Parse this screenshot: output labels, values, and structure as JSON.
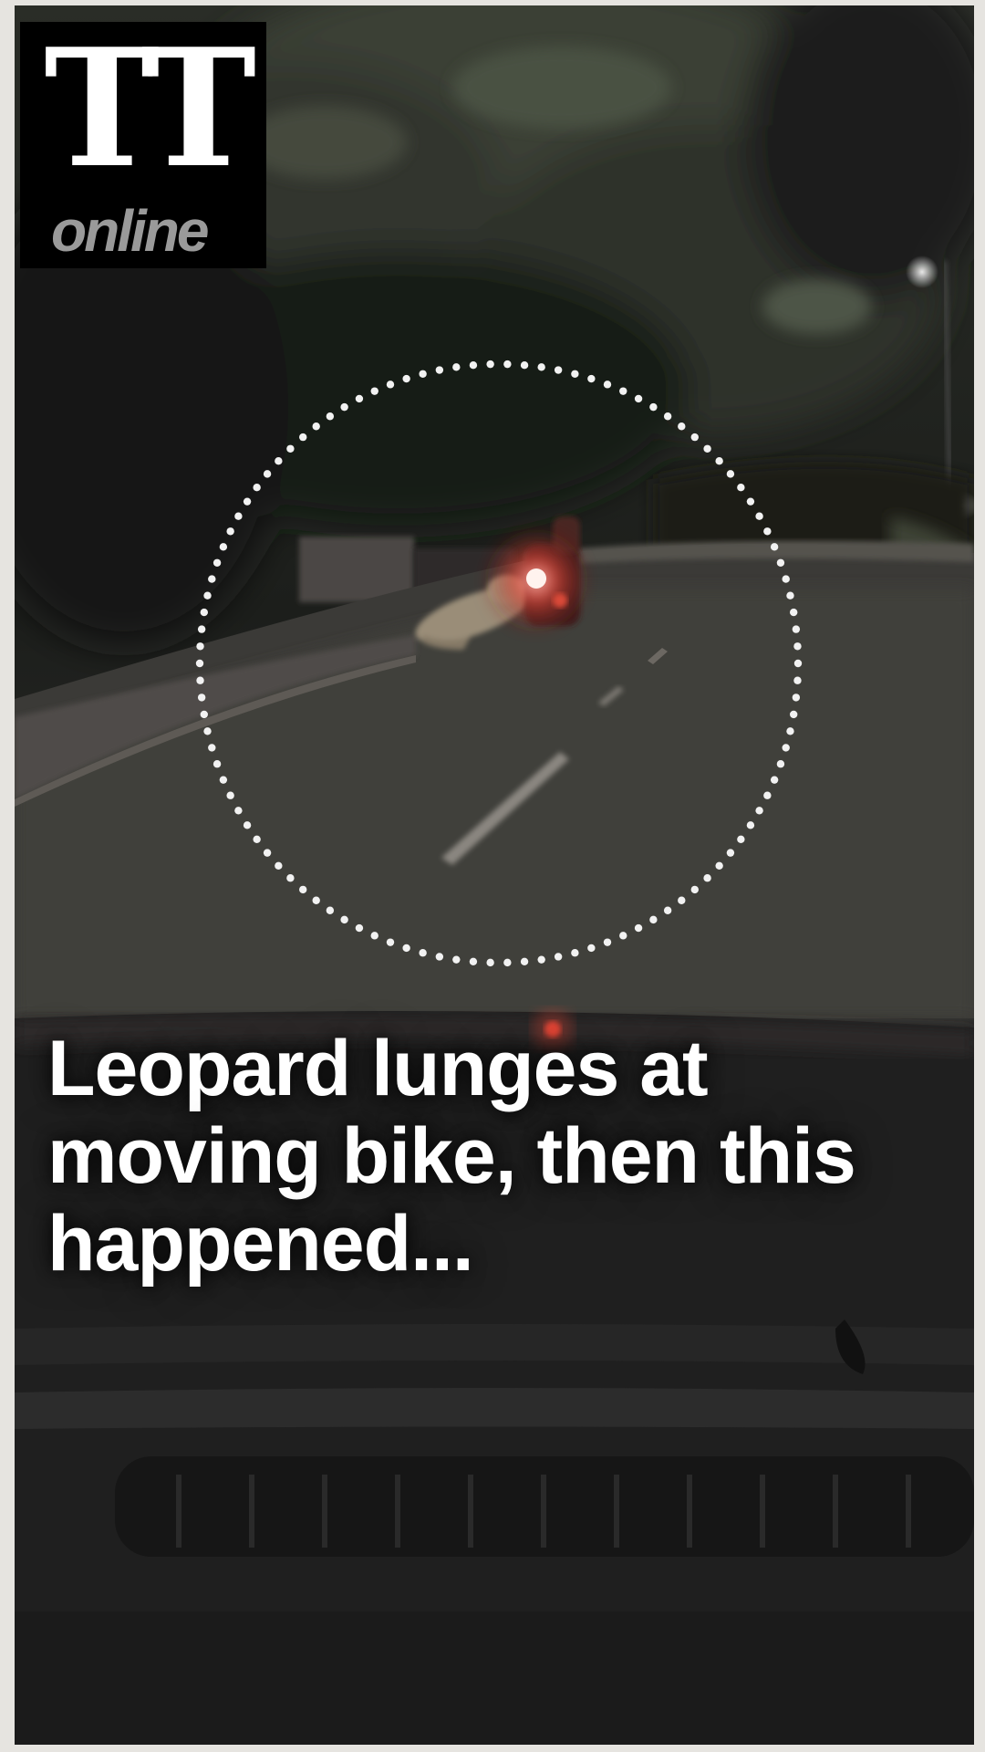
{
  "brand": {
    "logo_mark": "TT",
    "logo_word": "online"
  },
  "story": {
    "headline": "Leopard lunges at moving bike, then this happened..."
  },
  "video": {
    "scene": "night road dashcam view",
    "highlight": "dotted-circle"
  },
  "colors": {
    "page_bg": "#e6e4e0",
    "logo_bg": "#000000",
    "logo_mark": "#ffffff",
    "logo_word": "#9a9a9a",
    "headline": "#ffffff",
    "circle_dots": "#f2f2f2"
  }
}
